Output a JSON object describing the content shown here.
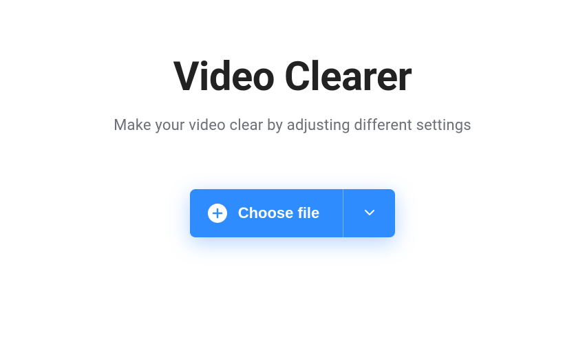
{
  "hero": {
    "title": "Video Clearer",
    "subtitle": "Make your video clear by adjusting different settings"
  },
  "upload": {
    "choose_label": "Choose file"
  }
}
